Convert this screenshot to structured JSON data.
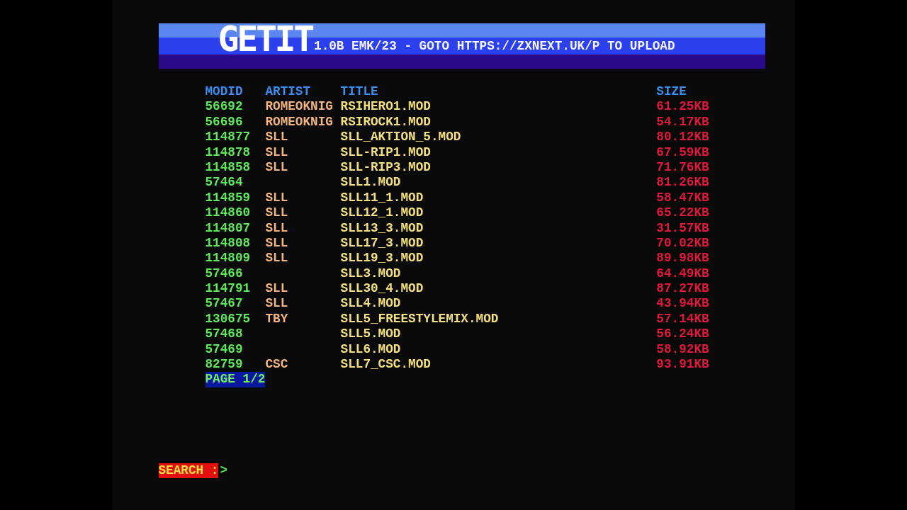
{
  "header": {
    "logo": "GETIT",
    "version_info": "1.0B EMK/23 - GOTO HTTPS://ZXNEXT.UK/P TO UPLOAD"
  },
  "table": {
    "columns": [
      "MODID",
      "ARTIST",
      "TITLE",
      "SIZE"
    ],
    "rows": [
      {
        "modid": "56692",
        "artist": "ROMEOKNIG",
        "title": "RSIHERO1.MOD",
        "size": "61.25KB"
      },
      {
        "modid": "56696",
        "artist": "ROMEOKNIG",
        "title": "RSIROCK1.MOD",
        "size": "54.17KB"
      },
      {
        "modid": "114877",
        "artist": "SLL",
        "title": "SLL_AKTION_5.MOD",
        "size": "80.12KB"
      },
      {
        "modid": "114878",
        "artist": "SLL",
        "title": "SLL-RIP1.MOD",
        "size": "67.59KB"
      },
      {
        "modid": "114858",
        "artist": "SLL",
        "title": "SLL-RIP3.MOD",
        "size": "71.76KB"
      },
      {
        "modid": "57464",
        "title": "SLL1.MOD",
        "size": "81.26KB"
      },
      {
        "modid": "114859",
        "artist": "SLL",
        "title": "SLL11_1.MOD",
        "size": "58.47KB"
      },
      {
        "modid": "114860",
        "artist": "SLL",
        "title": "SLL12_1.MOD",
        "size": "65.22KB"
      },
      {
        "modid": "114807",
        "artist": "SLL",
        "title": "SLL13_3.MOD",
        "size": "31.57KB"
      },
      {
        "modid": "114808",
        "artist": "SLL",
        "title": "SLL17_3.MOD",
        "size": "70.02KB"
      },
      {
        "modid": "114809",
        "artist": "SLL",
        "title": "SLL19_3.MOD",
        "size": "89.98KB"
      },
      {
        "modid": "57466",
        "title": "SLL3.MOD",
        "size": "64.49KB"
      },
      {
        "modid": "114791",
        "artist": "SLL",
        "title": "SLL30_4.MOD",
        "size": "87.27KB"
      },
      {
        "modid": "57467",
        "artist": "SLL",
        "title": "SLL4.MOD",
        "size": "43.94KB"
      },
      {
        "modid": "130675",
        "artist": "TBY",
        "title": "SLL5_FREESTYLEMIX.MOD",
        "size": "57.14KB"
      },
      {
        "modid": "57468",
        "title": "SLL5.MOD",
        "size": "56.24KB"
      },
      {
        "modid": "57469",
        "title": "SLL6.MOD",
        "size": "58.92KB"
      },
      {
        "modid": "82759",
        "artist": "CSC",
        "title": "SLL7_CSC.MOD",
        "size": "93.91KB"
      }
    ]
  },
  "pagination": {
    "label": "PAGE 1/2"
  },
  "search": {
    "label": "SEARCH :",
    "prompt": ">"
  }
}
